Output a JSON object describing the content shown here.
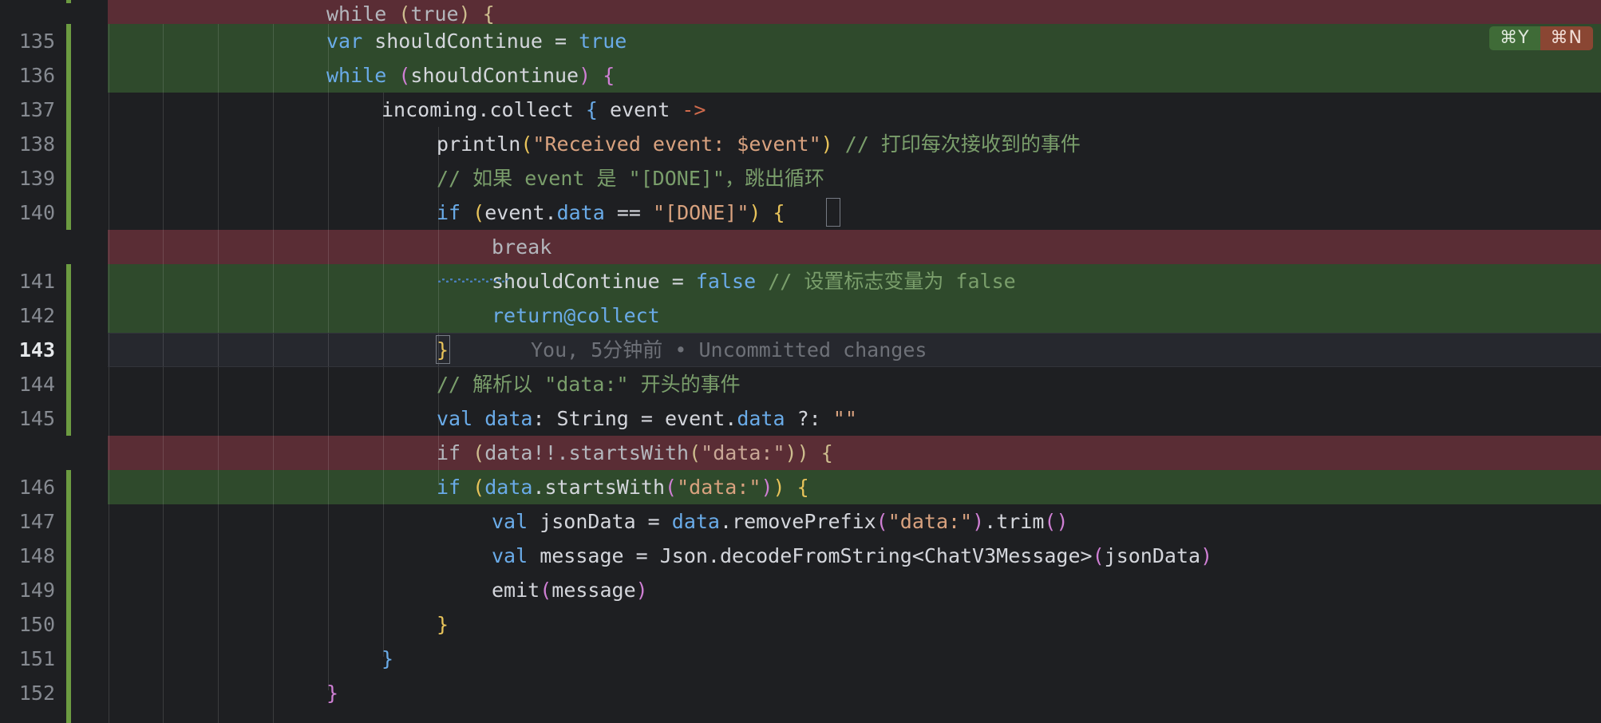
{
  "editor": {
    "theme": "dark",
    "language": "kotlin",
    "background": "#1e1f22",
    "deleted_bg": "#5a2d35",
    "added_bg": "#2f4a2c",
    "caret_line_bg": "#26282e",
    "change_bar_color": "#6c9b41"
  },
  "nav_badges": {
    "prev_label": "⌘Y",
    "next_label": "⌘N",
    "prev_name": "previous-change",
    "next_name": "next-change",
    "prev_color": "#3f6b37",
    "next_color": "#8a4633"
  },
  "blame": {
    "line": 143,
    "text": "You, 5分钟前 • Uncommitted changes",
    "author": "You",
    "when": "5分钟前",
    "status": "Uncommitted changes"
  },
  "lines": [
    {
      "num": "",
      "kind": "deleted",
      "indent": 5,
      "text": "while (true) {"
    },
    {
      "num": "135",
      "kind": "added",
      "indent": 5,
      "text": "var shouldContinue = true"
    },
    {
      "num": "136",
      "kind": "added",
      "indent": 5,
      "text": "while (shouldContinue) {"
    },
    {
      "num": "137",
      "kind": "normal",
      "indent": 6,
      "text": "incoming.collect { event ->"
    },
    {
      "num": "138",
      "kind": "normal",
      "indent": 7,
      "text": "println(\"Received event: $event\") // 打印每次接收到的事件"
    },
    {
      "num": "139",
      "kind": "normal",
      "indent": 7,
      "text": "// 如果 event 是 \"[DONE]\", 跳出循环"
    },
    {
      "num": "140",
      "kind": "normal",
      "indent": 7,
      "text": "if (event.data == \"[DONE]\") {"
    },
    {
      "num": "",
      "kind": "deleted",
      "indent": 8,
      "text": "break"
    },
    {
      "num": "141",
      "kind": "added",
      "indent": 8,
      "text": "shouldContinue = false // 设置标志变量为 false"
    },
    {
      "num": "142",
      "kind": "added",
      "indent": 8,
      "text": "return@collect"
    },
    {
      "num": "143",
      "kind": "caret",
      "indent": 7,
      "text": "}"
    },
    {
      "num": "144",
      "kind": "normal",
      "indent": 7,
      "text": "// 解析以 \"data:\" 开头的事件"
    },
    {
      "num": "145",
      "kind": "normal",
      "indent": 7,
      "text": "val data: String = event.data ?: \"\""
    },
    {
      "num": "",
      "kind": "deleted",
      "indent": 7,
      "text": "if (data!!.startsWith(\"data:\")) {"
    },
    {
      "num": "146",
      "kind": "added",
      "indent": 7,
      "text": "if (data.startsWith(\"data:\")) {"
    },
    {
      "num": "147",
      "kind": "normal",
      "indent": 8,
      "text": "val jsonData = data.removePrefix(\"data:\").trim()"
    },
    {
      "num": "148",
      "kind": "normal",
      "indent": 8,
      "text": "val message = Json.decodeFromString<ChatV3Message>(jsonData)"
    },
    {
      "num": "149",
      "kind": "normal",
      "indent": 8,
      "text": "emit(message)"
    },
    {
      "num": "150",
      "kind": "normal",
      "indent": 7,
      "text": "}"
    },
    {
      "num": "151",
      "kind": "normal",
      "indent": 6,
      "text": "}"
    },
    {
      "num": "152",
      "kind": "normal",
      "indent": 5,
      "text": "}"
    }
  ]
}
